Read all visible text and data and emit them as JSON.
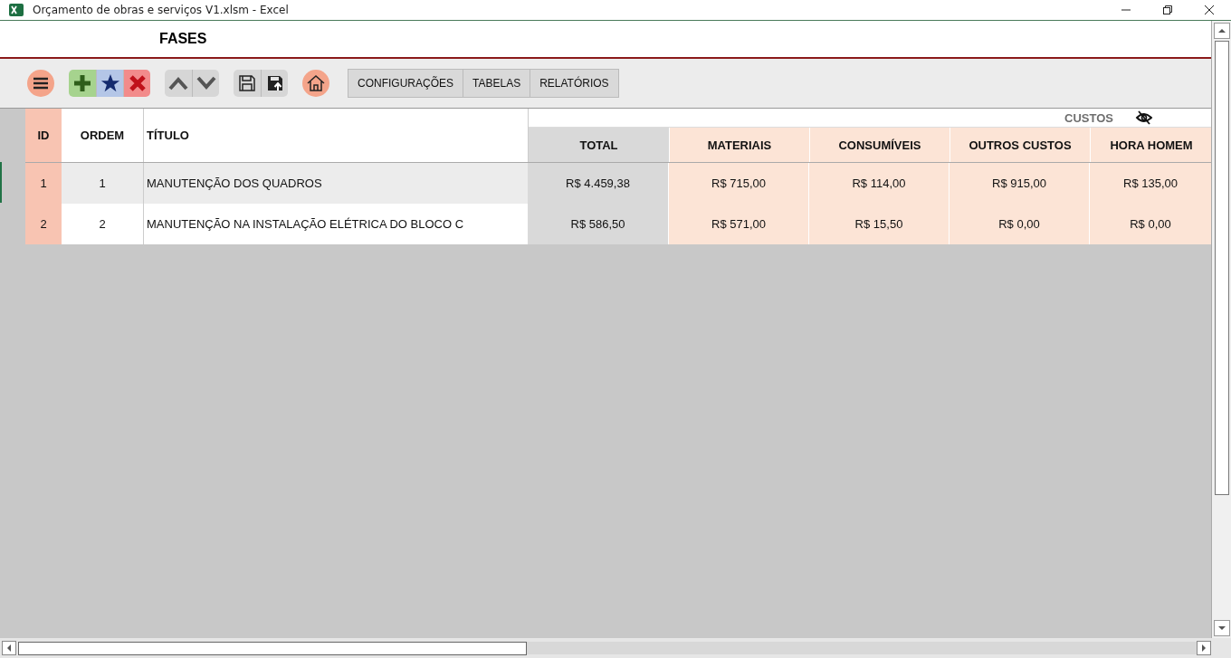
{
  "window": {
    "title": "Orçamento de obras e serviços V1.xlsm - Excel"
  },
  "sheet_title": "FASES",
  "toolbar": {
    "menu_buttons": [
      {
        "label": "CONFIGURAÇÕES"
      },
      {
        "label": "TABELAS"
      },
      {
        "label": "RELATÓRIOS"
      }
    ]
  },
  "table": {
    "group_header": "CUSTOS",
    "columns": [
      {
        "label": "ID",
        "kind": "id"
      },
      {
        "label": "ORDEM",
        "kind": "plain"
      },
      {
        "label": "TÍTULO",
        "kind": "title"
      },
      {
        "label": "TOTAL",
        "kind": "total"
      },
      {
        "label": "MATERIAIS",
        "kind": "cost"
      },
      {
        "label": "CONSUMÍVEIS",
        "kind": "cost"
      },
      {
        "label": "OUTROS CUSTOS",
        "kind": "cost"
      },
      {
        "label": "HORA HOMEM",
        "kind": "cost"
      }
    ],
    "rows": [
      {
        "selected": true,
        "cells": [
          "1",
          "1",
          "MANUTENÇÃO DOS QUADROS",
          "R$ 4.459,38",
          "R$ 715,00",
          "R$ 114,00",
          "R$ 915,00",
          "R$ 135,00"
        ]
      },
      {
        "selected": false,
        "cells": [
          "2",
          "2",
          "MANUTENÇÃO NA INSTALAÇÃO ELÉTRICA DO BLOCO C",
          "R$ 586,50",
          "R$ 571,00",
          "R$ 15,50",
          "R$ 0,00",
          "R$ 0,00"
        ]
      }
    ]
  }
}
